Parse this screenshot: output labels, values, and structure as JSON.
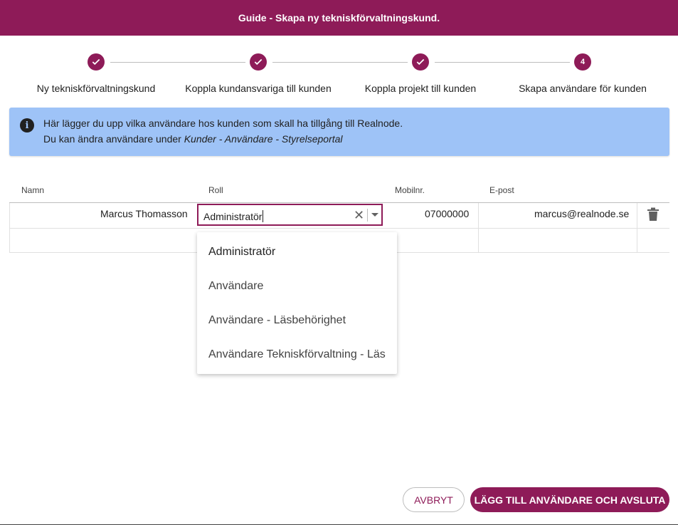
{
  "header": {
    "title": "Guide - Skapa ny tekniskförvaltningskund."
  },
  "stepper": {
    "steps": [
      {
        "label": "Ny tekniskförvaltningskund",
        "state": "done"
      },
      {
        "label": "Koppla kundansvariga till kunden",
        "state": "done"
      },
      {
        "label": "Koppla projekt till kunden",
        "state": "done"
      },
      {
        "label": "Skapa användare för kunden",
        "state": "active",
        "number": "4"
      }
    ]
  },
  "info": {
    "line1": "Här lägger du upp vilka användare hos kunden som skall ha tillgång till Realnode.",
    "line2_prefix": "Du kan ändra användare under ",
    "line2_italic": "Kunder - Användare - Styrelseportal"
  },
  "table": {
    "headers": {
      "name": "Namn",
      "role": "Roll",
      "mobile": "Mobilnr.",
      "email": "E-post"
    },
    "rows": [
      {
        "name": "Marcus Thomasson",
        "role": "Administratör",
        "mobile": "07000000",
        "email": "marcus@realnode.se"
      }
    ]
  },
  "role_dropdown": {
    "options": [
      "Administratör",
      "Användare",
      "Användare - Läsbehörighet",
      "Användare Tekniskförvaltning - Läs"
    ]
  },
  "footer": {
    "cancel_label": "AVBRYT",
    "submit_label": "LÄGG TILL ANVÄNDARE OCH AVSLUTA"
  },
  "colors": {
    "accent": "#8e1b58",
    "info_bg": "#9ec3f7"
  }
}
